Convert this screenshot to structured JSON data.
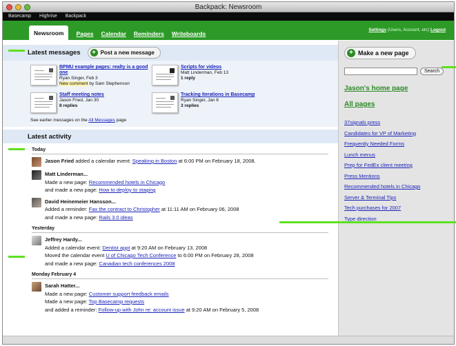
{
  "window": {
    "title": "Backpack: Newsroom"
  },
  "appbar": {
    "items": [
      "Basecamp",
      "Highrise",
      "Backpack"
    ]
  },
  "nav": {
    "tabs": [
      "Newsroom",
      "Pages",
      "Calendar",
      "Reminders",
      "Writeboards"
    ],
    "settings": "Settings",
    "settings_note": "(Users, Account, etc)",
    "logout": "Logout"
  },
  "messages": {
    "heading": "Latest messages",
    "post_button": "Post a new message",
    "items": [
      {
        "title": "BPMU example pages: realty is a good one",
        "meta": "Ryan Singer, Feb 3",
        "note_highlight": "New comment",
        "note_rest": " by Sam Stephenson"
      },
      {
        "title": "Scripts for videos",
        "meta": "Matt Linderman, Feb 13",
        "note_highlight": "",
        "note_rest": "1 reply"
      },
      {
        "title": "Staff meeting notes",
        "meta": "Jason Fried, Jan 30",
        "note_highlight": "",
        "note_rest": "8 replies"
      },
      {
        "title": "Tracking iterations in Basecamp",
        "meta": "Ryan Singer, Jan 8",
        "note_highlight": "",
        "note_rest": "3 replies"
      }
    ],
    "earlier_prefix": "See earlier messages on the ",
    "earlier_link": "All Messages",
    "earlier_suffix": " page"
  },
  "activity": {
    "heading": "Latest activity",
    "days": [
      {
        "label": "Today",
        "entries": [
          {
            "name": "Jason Fried",
            "lines": [
              {
                "pre": " added a calendar event: ",
                "link": "Speaking in Boston",
                "post": " at 6:00 PM on February 18, 2008."
              }
            ]
          },
          {
            "name": "Matt Linderman...",
            "lines": [
              {
                "pre": "Made a new page: ",
                "link": "Recommended hotels in Chicago",
                "post": ""
              },
              {
                "pre": "and made a new page: ",
                "link": "How to deploy to staging",
                "post": ""
              }
            ]
          },
          {
            "name": "David Heinemeier Hansson...",
            "lines": [
              {
                "pre": "Added a reminder: ",
                "link": "Fax the contract to Christopher",
                "post": " at 11:11 AM on February 06, 2008"
              },
              {
                "pre": "and made a new page: ",
                "link": "Rails 3.0 ideas",
                "post": ""
              }
            ]
          }
        ]
      },
      {
        "label": "Yesterday",
        "entries": [
          {
            "name": "Jeffrey Hardy...",
            "lines": [
              {
                "pre": "Added a calendar event: ",
                "link": "Dentist appt",
                "post": " at 9:20 AM on February 13, 2008"
              },
              {
                "pre": "Moved the calendar event ",
                "link": "U of Chicago Tech Conference",
                "post": " to 6:00 PM on February 28, 2008"
              },
              {
                "pre": "and made a new page: ",
                "link": "Canadian tech conferences 2008",
                "post": ""
              }
            ]
          }
        ]
      },
      {
        "label": "Monday February 4",
        "entries": [
          {
            "name": "Sarah Hatter...",
            "lines": [
              {
                "pre": "Made a new page: ",
                "link": "Customer support feedback emails",
                "post": ""
              },
              {
                "pre": "Made a new page: ",
                "link": "Top Basecamp requests",
                "post": ""
              },
              {
                "pre": "and added a reminder: ",
                "link": "Follow-up with John re: account issue",
                "post": " at 9:20 AM on February 5, 2008"
              }
            ]
          }
        ]
      }
    ]
  },
  "sidebar": {
    "new_page_button": "Make a new page",
    "search_button": "Search",
    "search_value": "",
    "home_link": "Jason's home page",
    "all_pages_link": "All pages",
    "pages": [
      "37signals press",
      "Candidates for VP of Marketing",
      "Frequently Needed Forms",
      "Lunch menus",
      "Prep for FedEx client meeting",
      "Press Mentions",
      "Recommended hotels in Chicago",
      "Server & Terminal Tips",
      "Tech purchases for 2007",
      "Type direction"
    ]
  },
  "colors": {
    "nav_green": "#2d9a27",
    "highlight_green": "#5ee01f",
    "link_blue": "#1a22b8",
    "section_blue": "#dfe9f5"
  }
}
